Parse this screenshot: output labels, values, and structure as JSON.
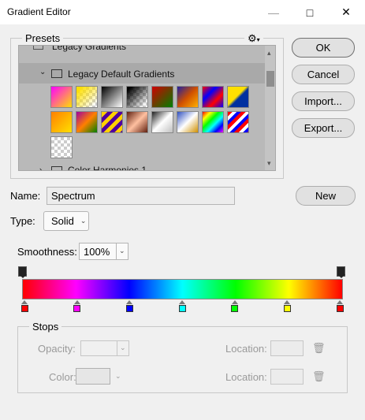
{
  "window": {
    "title": "Gradient Editor",
    "minimize": "—",
    "maximize": "□",
    "close": "✕"
  },
  "presets": {
    "label": "Presets",
    "menu_icon": "gear-icon",
    "folders": [
      "Legacy Gradients",
      "Legacy Default Gradients",
      "Color Harmonies 1"
    ]
  },
  "buttons": {
    "ok": "OK",
    "cancel": "Cancel",
    "import": "Import...",
    "export": "Export...",
    "new": "New"
  },
  "name": {
    "label": "Name:",
    "value": "Spectrum"
  },
  "type": {
    "label": "Type:",
    "value": "Solid"
  },
  "smoothness": {
    "label": "Smoothness:",
    "value": "100%"
  },
  "gradient": {
    "stops_colors": [
      "#ff0000",
      "#ff00ff",
      "#0000ff",
      "#00ffff",
      "#00ff00",
      "#ffff00",
      "#ff0000"
    ]
  },
  "stops": {
    "label": "Stops",
    "opacity_label": "Opacity:",
    "color_label": "Color:",
    "location1_label": "Location:",
    "location2_label": "Location:"
  }
}
